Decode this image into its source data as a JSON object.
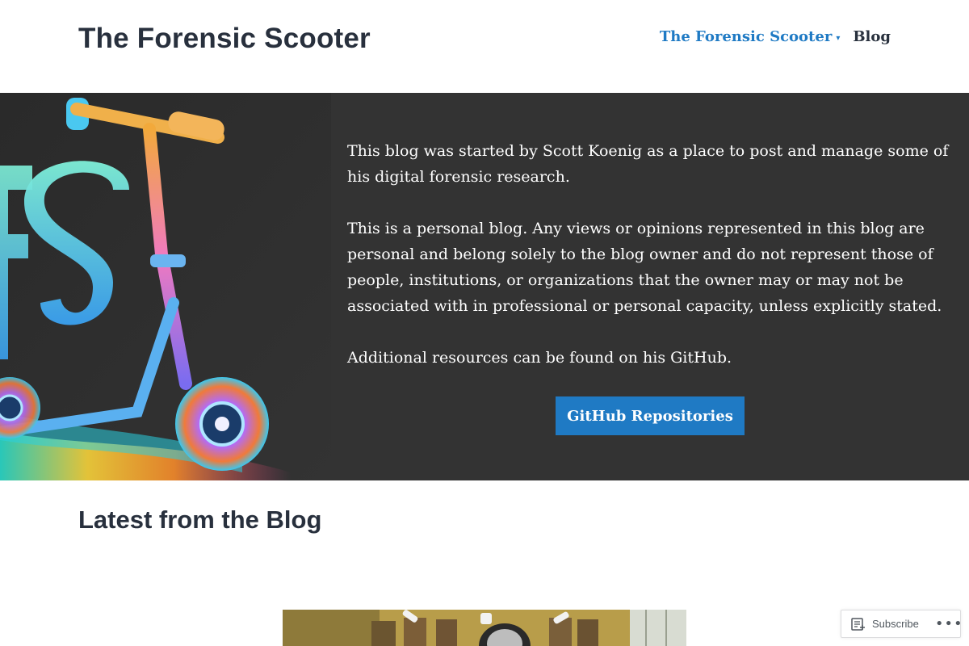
{
  "header": {
    "site_title": "The Forensic Scooter",
    "nav": [
      {
        "label": "The Forensic Scooter",
        "caret": "▾"
      },
      {
        "label": "Blog"
      }
    ]
  },
  "hero": {
    "image_icon": "scooter-logo-art",
    "paragraphs": [
      "This blog was started by Scott Koenig as a place to post and manage some of his digital forensic research.",
      "This is a personal blog. Any views or opinions represented in this blog are personal and belong solely to the blog owner and do not represent those of people, institutions, or organizations that the owner may or may not be associated with in professional or personal capacity, unless explicitly stated.",
      "Additional resources can be found on his GitHub."
    ],
    "button_label": "GitHub Repositories"
  },
  "latest": {
    "title": "Latest from the Blog"
  },
  "subscribe_bar": {
    "subscribe_label": "Subscribe",
    "more_label": "•••"
  },
  "colors": {
    "accent": "#1f7ac4",
    "hero_bg": "#333333",
    "text": "#28303d"
  }
}
